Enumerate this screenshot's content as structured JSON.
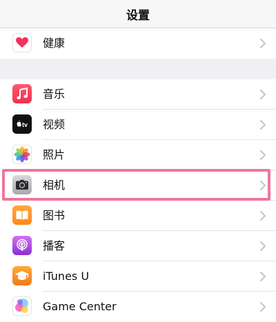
{
  "nav": {
    "title": "设置"
  },
  "health_group": [
    {
      "label": "健康",
      "icon": "health-heart-icon"
    }
  ],
  "media_group": [
    {
      "label": "音乐",
      "icon": "music-note-icon"
    },
    {
      "label": "视频",
      "icon": "apple-tv-icon",
      "icon_text": "tv"
    },
    {
      "label": "照片",
      "icon": "photos-flower-icon"
    },
    {
      "label": "相机",
      "icon": "camera-icon"
    },
    {
      "label": "图书",
      "icon": "books-icon"
    },
    {
      "label": "播客",
      "icon": "podcasts-icon"
    },
    {
      "label": "iTunes U",
      "icon": "itunes-u-icon"
    },
    {
      "label": "Game Center",
      "icon": "game-center-icon"
    }
  ],
  "highlighted_row": "相机",
  "colors": {
    "highlight_border": "#f0759c",
    "background": "#efeff4",
    "chevron": "#c4c4c7"
  }
}
